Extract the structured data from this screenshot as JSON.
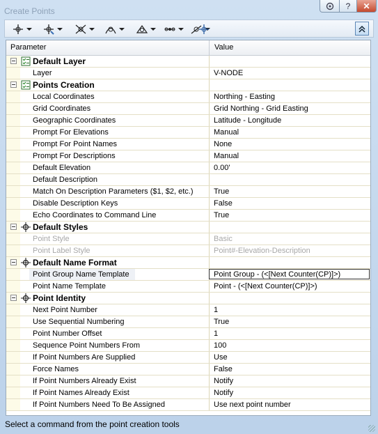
{
  "window": {
    "title": "Create Points"
  },
  "toolbar": {
    "tools": [
      "point-creation-icon",
      "point-tools-icon",
      "intersection-icon",
      "alignment-icon",
      "surface-icon",
      "interpolate-icon",
      "slope-icon",
      "import-points-icon"
    ]
  },
  "grid": {
    "header": {
      "parameter": "Parameter",
      "value": "Value"
    },
    "rows": [
      {
        "type": "category",
        "label": "Default Layer",
        "icon": "checklist-icon"
      },
      {
        "label": "Layer",
        "value": "V-NODE"
      },
      {
        "type": "category",
        "label": "Points Creation",
        "icon": "checklist-icon"
      },
      {
        "label": "Local Coordinates",
        "value": "Northing - Easting"
      },
      {
        "label": "Grid Coordinates",
        "value": "Grid Northing - Grid Easting"
      },
      {
        "label": "Geographic Coordinates",
        "value": "Latitude - Longitude"
      },
      {
        "label": "Prompt For Elevations",
        "value": "Manual"
      },
      {
        "label": "Prompt For Point Names",
        "value": "None"
      },
      {
        "label": "Prompt For Descriptions",
        "value": "Manual"
      },
      {
        "label": "Default Elevation",
        "value": "0.00'"
      },
      {
        "label": "Default Description",
        "value": ""
      },
      {
        "label": "Match On Description Parameters ($1, $2, etc.)",
        "value": "True"
      },
      {
        "label": "Disable Description Keys",
        "value": "False"
      },
      {
        "label": "Echo Coordinates to Command Line",
        "value": "True"
      },
      {
        "type": "category",
        "label": "Default Styles",
        "icon": "target-icon"
      },
      {
        "label": "Point Style",
        "value": "Basic",
        "disabled": true
      },
      {
        "label": "Point Label Style",
        "value": "Point#-Elevation-Description",
        "disabled": true
      },
      {
        "type": "category",
        "label": "Default Name Format",
        "icon": "target-icon"
      },
      {
        "label": "Point Group Name Template",
        "value": "Point Group - (<[Next Counter(CP)]>)",
        "selected": true
      },
      {
        "label": "Point Name Template",
        "value": "Point - (<[Next Counter(CP)]>)"
      },
      {
        "type": "category",
        "label": "Point Identity",
        "icon": "target-icon"
      },
      {
        "label": "Next Point Number",
        "value": "1"
      },
      {
        "label": "Use Sequential Numbering",
        "value": "True"
      },
      {
        "label": "Point Number Offset",
        "value": "1"
      },
      {
        "label": "Sequence Point Numbers From",
        "value": "100"
      },
      {
        "label": "If Point Numbers Are Supplied",
        "value": "Use"
      },
      {
        "label": "Force Names",
        "value": "False"
      },
      {
        "label": "If Point Numbers Already Exist",
        "value": "Notify"
      },
      {
        "label": "If Point Names Already Exist",
        "value": "Notify"
      },
      {
        "label": "If Point Numbers Need To Be Assigned",
        "value": "Use next point number"
      }
    ]
  },
  "status": {
    "text": "Select a command from the point creation tools"
  }
}
